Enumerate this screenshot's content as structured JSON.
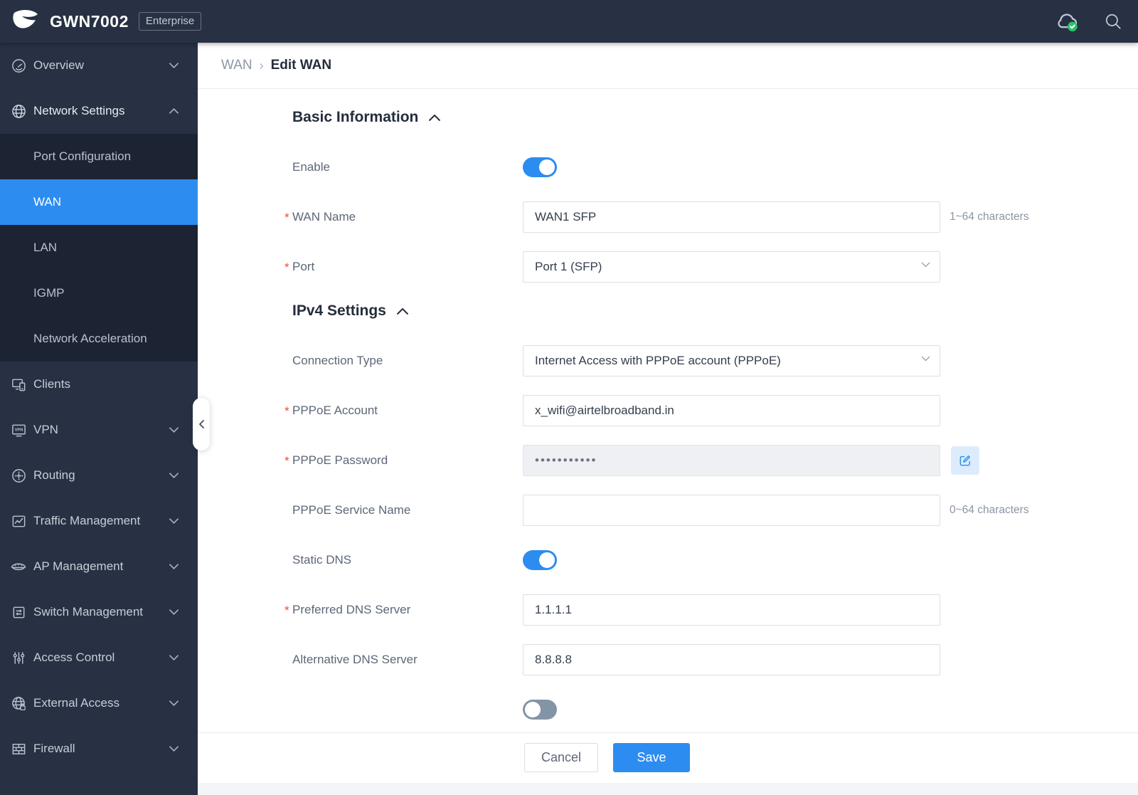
{
  "header": {
    "title": "GWN7002",
    "badge": "Enterprise",
    "icons": {
      "cloud": "cloud-status-connected",
      "search": "search"
    }
  },
  "sidebar": {
    "items": [
      {
        "label": "Overview",
        "icon": "gauge-icon",
        "chevron": "down"
      },
      {
        "label": "Network Settings",
        "icon": "globe-icon",
        "chevron": "up"
      },
      {
        "label": "Clients",
        "icon": "clients-icon",
        "chevron": "none"
      },
      {
        "label": "VPN",
        "icon": "vpn-icon",
        "icon_text": "VPN",
        "chevron": "down"
      },
      {
        "label": "Routing",
        "icon": "routing-icon",
        "chevron": "down"
      },
      {
        "label": "Traffic Management",
        "icon": "traffic-icon",
        "chevron": "down"
      },
      {
        "label": "AP Management",
        "icon": "ap-icon",
        "chevron": "down"
      },
      {
        "label": "Switch Management",
        "icon": "switch-icon",
        "chevron": "down"
      },
      {
        "label": "Access Control",
        "icon": "access-control-icon",
        "chevron": "down"
      },
      {
        "label": "External Access",
        "icon": "external-access-icon",
        "chevron": "down"
      },
      {
        "label": "Firewall",
        "icon": "firewall-icon",
        "chevron": "down"
      }
    ],
    "submenu": [
      {
        "label": "Port Configuration",
        "active": false
      },
      {
        "label": "WAN",
        "active": true
      },
      {
        "label": "LAN",
        "active": false
      },
      {
        "label": "IGMP",
        "active": false
      },
      {
        "label": "Network Acceleration",
        "active": false
      }
    ]
  },
  "breadcrumb": {
    "parent": "WAN",
    "separator": "›",
    "current": "Edit WAN"
  },
  "ui": {
    "required_marker": "*"
  },
  "form": {
    "sections": {
      "basic": {
        "title": "Basic Information"
      },
      "ipv4": {
        "title": "IPv4 Settings"
      }
    },
    "fields": {
      "enable": {
        "label": "Enable",
        "state": "on"
      },
      "wan_name": {
        "label": "WAN Name",
        "value": "WAN1 SFP",
        "hint": "1~64 characters"
      },
      "port": {
        "label": "Port",
        "value": "Port 1 (SFP)"
      },
      "connection_type": {
        "label": "Connection Type",
        "value": "Internet Access with PPPoE account (PPPoE)"
      },
      "pppoe_account": {
        "label": "PPPoE Account",
        "value": "x_wifi@airtelbroadband.in"
      },
      "pppoe_password": {
        "label": "PPPoE Password",
        "value": "•••••••••••"
      },
      "pppoe_service_name": {
        "label": "PPPoE Service Name",
        "value": "",
        "hint": "0~64 characters"
      },
      "static_dns": {
        "label": "Static DNS",
        "state": "on"
      },
      "preferred_dns": {
        "label": "Preferred DNS Server",
        "value": "1.1.1.1"
      },
      "alternative_dns": {
        "label": "Alternative DNS Server",
        "value": "8.8.8.8"
      }
    },
    "footer": {
      "cancel_label": "Cancel",
      "save_label": "Save"
    }
  },
  "colors": {
    "accent": "#2d8cf0",
    "success": "#27c26c",
    "danger": "#f0483e",
    "sidebar": "#273143",
    "submenu": "#1c2433"
  }
}
